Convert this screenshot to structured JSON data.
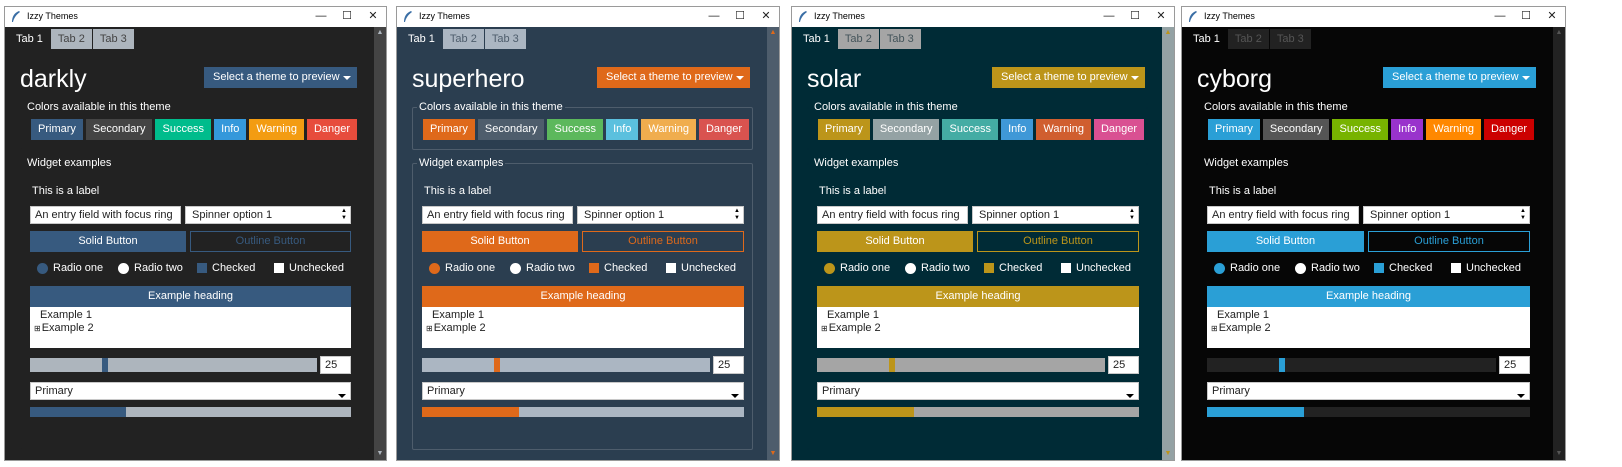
{
  "window_title": "Izzy Themes",
  "tabs": [
    "Tab 1",
    "Tab 2",
    "Tab 3"
  ],
  "select_label": "Select a theme to preview",
  "colors_section": "Colors available in this theme",
  "color_labels": [
    "Primary",
    "Secondary",
    "Success",
    "Info",
    "Warning",
    "Danger"
  ],
  "widgets_section": "Widget examples",
  "label_text": "This is a label",
  "entry_value": "An entry field with focus ring",
  "spinner_value": "Spinner option 1",
  "solid_button": "Solid Button",
  "outline_button": "Outline Button",
  "radio_one": "Radio one",
  "radio_two": "Radio two",
  "checked": "Checked",
  "unchecked": "Unchecked",
  "tree_heading": "Example heading",
  "tree_item_1": "Example 1",
  "tree_item_2": "Example 2",
  "scale_value": "25",
  "combo_value": "Primary",
  "progress_fraction": 0.3,
  "scale_fraction": 0.25,
  "themes": [
    {
      "name": "darkly",
      "bg": "#222222",
      "fg": "#ffffff",
      "border": "#222222",
      "primary": "#375a7f",
      "secondary": "#444444",
      "success": "#00bc8c",
      "info": "#3498db",
      "warning": "#f39c12",
      "danger": "#e74c3c",
      "trough": "#adb5bd",
      "tab_active_bg": "#222222",
      "tab_active_fg": "#ffffff",
      "tab_bg": "#adb5bd",
      "tab_fg": "#444444",
      "scroll_bg": "#444444",
      "scroll_arrow": "#adb5bd",
      "select_fg": "#ffffff"
    },
    {
      "name": "superhero",
      "bg": "#2b3e50",
      "fg": "#ffffff",
      "border": "#4e5d6c",
      "primary": "#df691a",
      "secondary": "#4e5d6c",
      "success": "#5cb85c",
      "info": "#5bc0de",
      "warning": "#f0ad4e",
      "danger": "#d9534f",
      "trough": "#abb6c2",
      "tab_active_bg": "#2b3e50",
      "tab_active_fg": "#ffffff",
      "tab_bg": "#abb6c2",
      "tab_fg": "#4e5d6c",
      "scroll_bg": "#4e5d6c",
      "scroll_arrow": "#df691a",
      "select_fg": "#ffffff"
    },
    {
      "name": "solar",
      "bg": "#002b36",
      "fg": "#ffffff",
      "border": "#002b36",
      "primary": "#bc951a",
      "secondary": "#94a2a4",
      "success": "#44aca4",
      "info": "#3f98d7",
      "warning": "#d05e2f",
      "danger": "#d95092",
      "trough": "#a5a5a5",
      "tab_active_bg": "#002b36",
      "tab_active_fg": "#ffffff",
      "tab_bg": "#a5a5a5",
      "tab_fg": "#44545a",
      "scroll_bg": "#94a2a4",
      "scroll_arrow": "#bc951a",
      "select_fg": "#ffffff"
    },
    {
      "name": "cyborg",
      "bg": "#060606",
      "fg": "#ffffff",
      "border": "#060606",
      "primary": "#2a9fd6",
      "secondary": "#555555",
      "success": "#77b300",
      "info": "#9933cc",
      "warning": "#ff8800",
      "danger": "#cc0000",
      "trough": "#222222",
      "tab_active_bg": "#060606",
      "tab_active_fg": "#ffffff",
      "tab_bg": "#222222",
      "tab_fg": "#555555",
      "scroll_bg": "#222222",
      "scroll_arrow": "#555555",
      "select_fg": "#ffffff"
    }
  ]
}
